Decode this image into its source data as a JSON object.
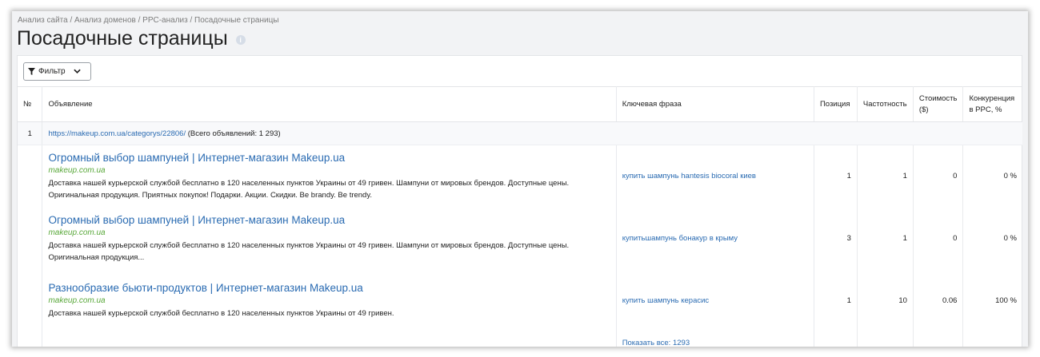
{
  "breadcrumb": "Анализ сайта / Анализ доменов / PPC-анализ / Посадочные страницы",
  "page_title": "Посадочные страницы",
  "info_icon": "i",
  "filter": {
    "label": "Фильтр"
  },
  "table": {
    "headers": {
      "num": "№",
      "ad": "Объявление",
      "keyword": "Ключевая фраза",
      "position": "Позиция",
      "frequency": "Частотность",
      "cost_line1": "Стоимость",
      "cost_line2": "($)",
      "competition_line1": "Конкуренция",
      "competition_line2": "в PPC, %"
    },
    "group": {
      "num": "1",
      "url": "https://makeup.com.ua/categorys/22806/",
      "total": "(Всего объявлений: 1 293)"
    },
    "rows": [
      {
        "title": "Огромный выбор шампуней | Интернет-магазин Makeup.ua",
        "domain": "makeup.com.ua",
        "desc": "Доставка нашей курьерской службой бесплатно в 120 населенных пунктов Украины от 49 гривен. Шампуни от мировых брендов. Доступные цены. Оригинальная продукция. Приятных покупок! Подарки. Акции. Скидки. Be brandy. Be trendy.",
        "keyword": "купить шампунь hantesis biocoral киев",
        "position": "1",
        "frequency": "1",
        "cost": "0",
        "competition": "0 %"
      },
      {
        "title": "Огромный выбор шампуней | Интернет-магазин Makeup.ua",
        "domain": "makeup.com.ua",
        "desc": "Доставка нашей курьерской службой бесплатно в 120 населенных пунктов Украины от 49 гривен. Шампуни от мировых брендов. Доступные цены. Оригинальная продукция...",
        "keyword": "купитьшампунь бонакур в крыму",
        "position": "3",
        "frequency": "1",
        "cost": "0",
        "competition": "0 %"
      },
      {
        "title": "Разнообразие бьюти-продуктов | Интернет-магазин Makeup.ua",
        "domain": "makeup.com.ua",
        "desc": "Доставка нашей курьерской службой бесплатно в 120 населенных пунктов Украины от 49 гривен.",
        "keyword": "купить шампунь керасис",
        "position": "1",
        "frequency": "10",
        "cost": "0.06",
        "competition": "100 %"
      }
    ],
    "show_all": "Показать все: 1293"
  }
}
